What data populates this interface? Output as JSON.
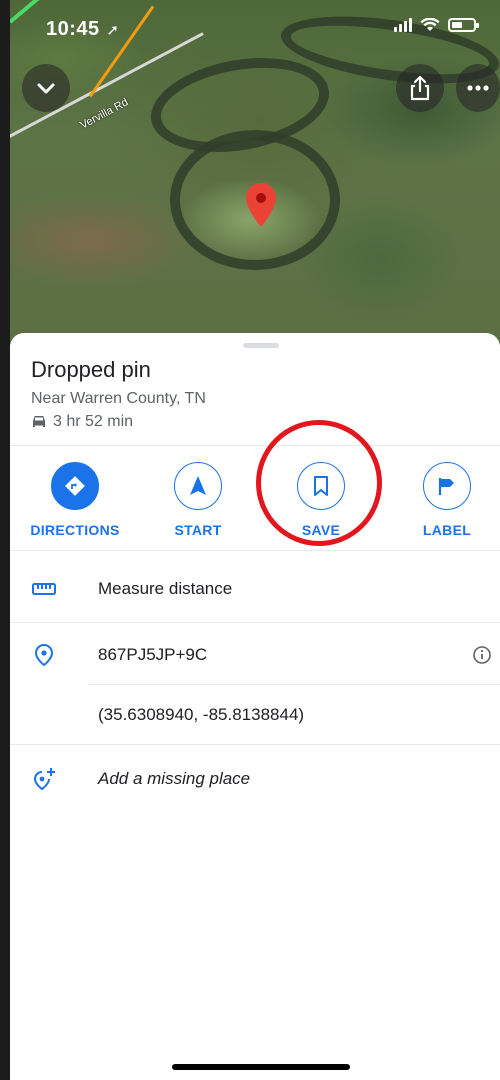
{
  "status_bar": {
    "time": "10:45",
    "location_arrow": "location-arrow-icon"
  },
  "map": {
    "road_label": "Vervilla Rd"
  },
  "place": {
    "title": "Dropped pin",
    "subtitle": "Near Warren County, TN",
    "drive_time": "3 hr 52 min"
  },
  "actions": [
    {
      "label": "DIRECTIONS",
      "icon": "directions-icon"
    },
    {
      "label": "START",
      "icon": "navigation-arrow-icon"
    },
    {
      "label": "SAVE",
      "icon": "bookmark-icon"
    },
    {
      "label": "LABEL",
      "icon": "flag-icon"
    }
  ],
  "rows": {
    "measure": "Measure distance",
    "plus_code": "867PJ5JP+9C",
    "coordinates": "(35.6308940, -85.8138844)",
    "missing_place": "Add a missing place"
  },
  "colors": {
    "accent": "#1a73e8",
    "pin": "#ea4335",
    "highlight": "#e4161d"
  }
}
